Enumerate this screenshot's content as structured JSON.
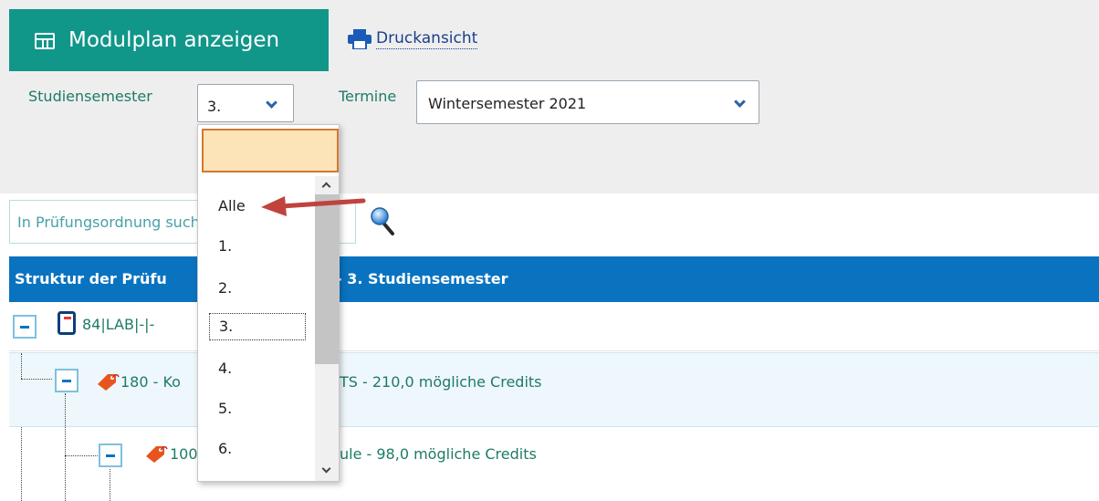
{
  "toolbar": {
    "modulplan_label": "Modulplan anzeigen",
    "print_label": "Druckansicht",
    "accent_color": "#11968a"
  },
  "filters": {
    "semester_label": "Studiensemester",
    "semester_value": "3.",
    "termine_label": "Termine",
    "termine_value": "Wintersemester 2021"
  },
  "search": {
    "placeholder": "In Prüfungsordnung suchen"
  },
  "header": {
    "part1": "Struktur der Prüfu",
    "part2": "- 3. Studiensemester",
    "color": "#0a73c0"
  },
  "tree": {
    "row1": {
      "text": "84|LAB|-|-"
    },
    "row2": {
      "text_a": "180 - Ko",
      "text_b": "TS - 210,0 mögliche Credits"
    },
    "row3": {
      "text_a": "100",
      "text_b": "ule - 98,0 mögliche Credits"
    }
  },
  "dropdown": {
    "filter_value": "",
    "options": [
      "Alle",
      "1.",
      "2.",
      "3.",
      "4.",
      "5.",
      "6."
    ],
    "focused_option": "3."
  },
  "icons": {
    "table": "table-grid-icon",
    "print": "printer-icon",
    "search": "magnifier-icon",
    "book": "book-icon",
    "tag": "tag-icon"
  }
}
